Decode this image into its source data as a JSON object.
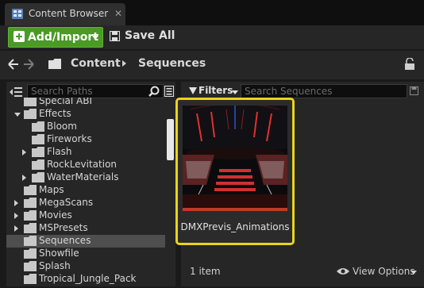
{
  "tab": {
    "title": "Content Browser",
    "close_glyph": "✕",
    "icon": "content-browser-icon"
  },
  "toolbar": {
    "add_import_label": "Add/Import",
    "save_all_label": "Save All"
  },
  "breadcrumb": {
    "items": [
      "Content",
      "Sequences"
    ]
  },
  "sources": {
    "search_placeholder": "Search Paths",
    "tree": [
      {
        "label": "Special ABI",
        "indent": 1,
        "expander": "none"
      },
      {
        "label": "Effects",
        "indent": 1,
        "expander": "down"
      },
      {
        "label": "Bloom",
        "indent": 2,
        "expander": "none"
      },
      {
        "label": "Fireworks",
        "indent": 2,
        "expander": "none"
      },
      {
        "label": "Flash",
        "indent": 2,
        "expander": "right"
      },
      {
        "label": "RockLevitation",
        "indent": 2,
        "expander": "none"
      },
      {
        "label": "WaterMaterials",
        "indent": 2,
        "expander": "right"
      },
      {
        "label": "Maps",
        "indent": 1,
        "expander": "none"
      },
      {
        "label": "MegaScans",
        "indent": 1,
        "expander": "right"
      },
      {
        "label": "Movies",
        "indent": 1,
        "expander": "right"
      },
      {
        "label": "MSPresets",
        "indent": 1,
        "expander": "right"
      },
      {
        "label": "Sequences",
        "indent": 1,
        "expander": "none",
        "selected": true
      },
      {
        "label": "Showfile",
        "indent": 1,
        "expander": "none"
      },
      {
        "label": "Splash",
        "indent": 1,
        "expander": "none"
      },
      {
        "label": "Tropical_Jungle_Pack",
        "indent": 1,
        "expander": "none"
      }
    ]
  },
  "assets": {
    "filters_label": "Filters",
    "search_placeholder": "Search Sequences",
    "items": [
      {
        "name": "DMXPrevis_Animations",
        "type_color": "#c0392b"
      }
    ],
    "item_count": "1 item",
    "view_options_label": "View Options"
  },
  "colors": {
    "selection_highlight": "#e8d41c",
    "add_button": "#4a9a25",
    "folder": "#c8c8c8"
  }
}
